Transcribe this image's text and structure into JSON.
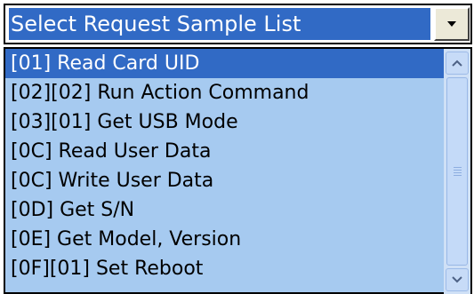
{
  "combo": {
    "selected_text": "Select Request Sample List",
    "dropdown_icon": "chevron-down-icon"
  },
  "list": {
    "items": [
      {
        "label": "[01] Read Card UID",
        "selected": true
      },
      {
        "label": "[02][02] Run Action Command",
        "selected": false
      },
      {
        "label": "[03][01] Get USB Mode",
        "selected": false
      },
      {
        "label": "[0C] Read User Data",
        "selected": false
      },
      {
        "label": "[0C] Write User Data",
        "selected": false
      },
      {
        "label": "[0D] Get S/N",
        "selected": false
      },
      {
        "label": "[0E] Get Model, Version",
        "selected": false
      },
      {
        "label": "[0F][01] Set Reboot",
        "selected": false
      }
    ]
  },
  "scrollbar": {
    "up_icon": "chevron-up-icon",
    "down_icon": "chevron-down-icon"
  },
  "colors": {
    "selection": "#316ac5",
    "list_background": "#a6caf0"
  }
}
